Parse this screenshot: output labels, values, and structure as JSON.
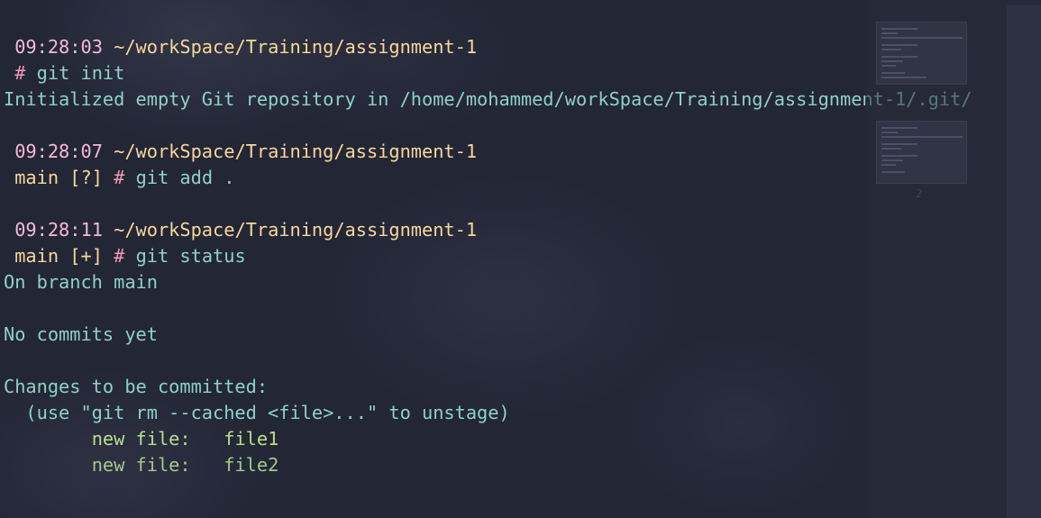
{
  "terminal": {
    "blocks": [
      {
        "time": "09:28:03",
        "path": "~/workSpace/Training/assignment-1",
        "branch": "",
        "symbol": "#",
        "command": "git init",
        "output": [
          "Initialized empty Git repository in /home/mohammed/workSpace/Training/assignment-1/.git/"
        ]
      },
      {
        "time": "09:28:07",
        "path": "~/workSpace/Training/assignment-1",
        "branch": "main [?]",
        "symbol": "#",
        "command": "git add ."
      },
      {
        "time": "09:28:11",
        "path": "~/workSpace/Training/assignment-1",
        "branch": "main [+]",
        "symbol": "#",
        "command": "git status",
        "output": [
          "On branch main",
          "",
          "No commits yet",
          "",
          "Changes to be committed:",
          "  (use \"git rm --cached <file>...\" to unstage)"
        ],
        "staged": [
          {
            "status": "new file:",
            "file": "file1"
          },
          {
            "status": "new file:",
            "file": "file2"
          }
        ]
      }
    ]
  },
  "workspace_overview": {
    "workspaces": [
      {
        "label": ""
      },
      {
        "label": "2"
      }
    ]
  },
  "colors": {
    "background": "#232635",
    "time": "#f5b9d8",
    "path": "#f6d79b",
    "prompt_symbol": "#f39ab5",
    "command_text": "#8ed1c6",
    "staged_file": "#b5e08b"
  }
}
